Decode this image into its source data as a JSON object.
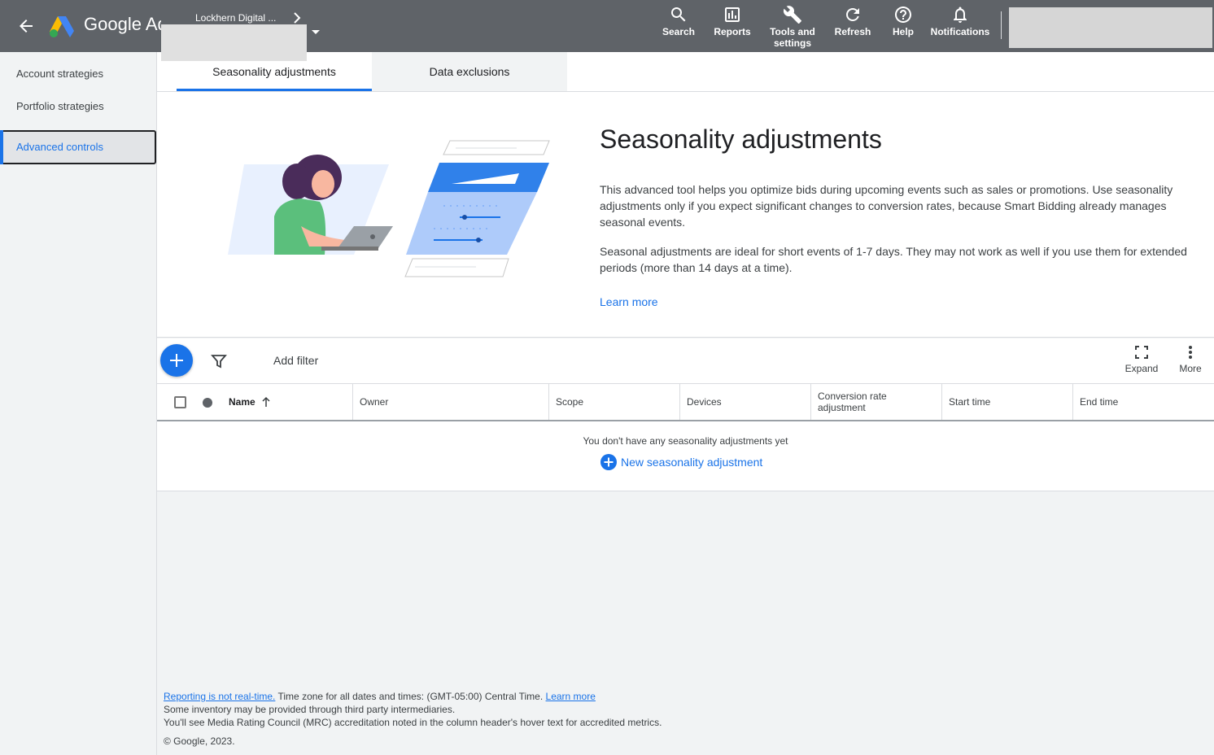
{
  "header": {
    "product_name": "Google Ads",
    "account_name": "Lockhern Digital ...",
    "tools": [
      {
        "label": "Search",
        "icon": "search-icon"
      },
      {
        "label": "Reports",
        "icon": "reports-icon"
      },
      {
        "label": "Tools and settings",
        "icon": "wrench-icon"
      },
      {
        "label": "Refresh",
        "icon": "refresh-icon"
      },
      {
        "label": "Help",
        "icon": "help-icon"
      },
      {
        "label": "Notifications",
        "icon": "bell-icon"
      }
    ],
    "colors": {
      "bar": "#5f6368",
      "accent": "#1a73e8"
    }
  },
  "sidebar": {
    "items": [
      {
        "label": "Account strategies",
        "active": false
      },
      {
        "label": "Portfolio strategies",
        "active": false
      },
      {
        "label": "Advanced controls",
        "active": true
      }
    ]
  },
  "tabs": [
    {
      "label": "Seasonality adjustments",
      "selected": true
    },
    {
      "label": "Data exclusions",
      "selected": false
    }
  ],
  "hero": {
    "title": "Seasonality adjustments",
    "paragraph1": "This advanced tool helps you optimize bids during upcoming events such as sales or promotions. Use seasonality adjustments only if you expect significant changes to conversion rates, because Smart Bidding already manages seasonal events.",
    "paragraph2": "Seasonal adjustments are ideal for short events of 1-7 days. They may not work as well if you use them for extended periods (more than 14 days at a time).",
    "learn_more": "Learn more"
  },
  "toolbar": {
    "add_filter": "Add filter",
    "expand": "Expand",
    "more": "More"
  },
  "table": {
    "columns": [
      "Name",
      "Owner",
      "Scope",
      "Devices",
      "Conversion rate adjustment",
      "Start time",
      "End time"
    ],
    "empty_message": "You don't have any seasonality adjustments yet",
    "new_link": "New seasonality adjustment"
  },
  "footer": {
    "reporting_link": "Reporting is not real-time.",
    "timezone": " Time zone for all dates and times: (GMT-05:00) Central Time. ",
    "learn_more": "Learn more",
    "line2": "Some inventory may be provided through third party intermediaries.",
    "line3": "You'll see Media Rating Council (MRC) accreditation noted in the column header's hover text for accredited metrics.",
    "copyright": "© Google, 2023."
  }
}
